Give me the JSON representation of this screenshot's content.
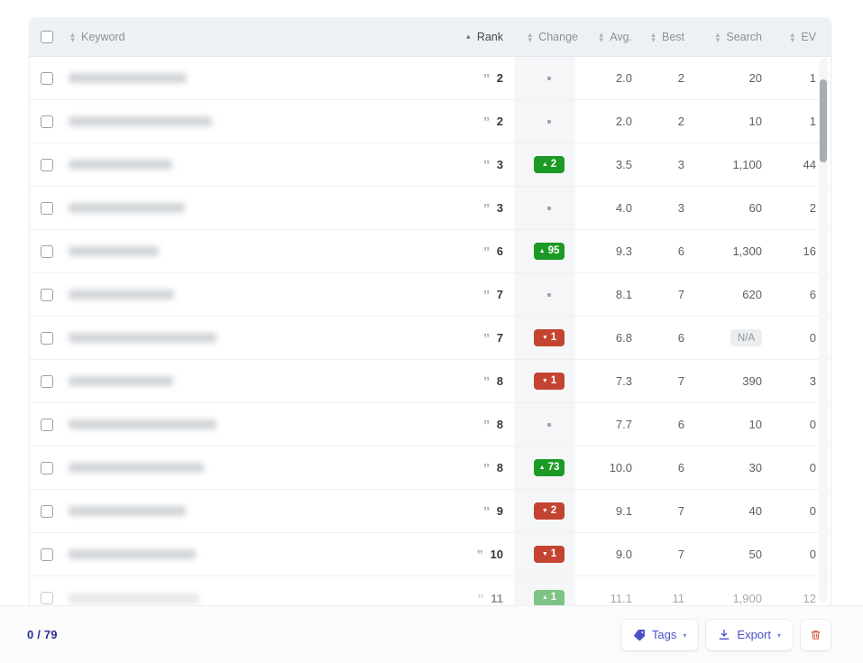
{
  "table": {
    "columns": [
      {
        "key": "select",
        "label": "",
        "sort": "none"
      },
      {
        "key": "keyword",
        "label": "Keyword",
        "sort": "both"
      },
      {
        "key": "rank",
        "label": "Rank",
        "sort": "asc"
      },
      {
        "key": "change",
        "label": "Change",
        "sort": "both"
      },
      {
        "key": "avg",
        "label": "Avg.",
        "sort": "both"
      },
      {
        "key": "best",
        "label": "Best",
        "sort": "both"
      },
      {
        "key": "search",
        "label": "Search",
        "sort": "both"
      },
      {
        "key": "ev",
        "label": "EV",
        "sort": "both"
      }
    ],
    "rank_icon": "quote-icon",
    "rows": [
      {
        "keyword": "",
        "keyword_redacted": true,
        "keyword_width": 131,
        "rank": "2",
        "change": "",
        "change_dir": "none",
        "avg": "2.0",
        "best": "2",
        "search": "20",
        "ev": "1"
      },
      {
        "keyword": "",
        "keyword_redacted": true,
        "keyword_width": 159,
        "rank": "2",
        "change": "",
        "change_dir": "none",
        "avg": "2.0",
        "best": "2",
        "search": "10",
        "ev": "1"
      },
      {
        "keyword": "",
        "keyword_redacted": true,
        "keyword_width": 115,
        "rank": "3",
        "change": "2",
        "change_dir": "up",
        "avg": "3.5",
        "best": "3",
        "search": "1,100",
        "ev": "44"
      },
      {
        "keyword": "",
        "keyword_redacted": true,
        "keyword_width": 129,
        "rank": "3",
        "change": "",
        "change_dir": "none",
        "avg": "4.0",
        "best": "3",
        "search": "60",
        "ev": "2"
      },
      {
        "keyword": "",
        "keyword_redacted": true,
        "keyword_width": 100,
        "rank": "6",
        "change": "95",
        "change_dir": "up",
        "avg": "9.3",
        "best": "6",
        "search": "1,300",
        "ev": "16"
      },
      {
        "keyword": "",
        "keyword_redacted": true,
        "keyword_width": 117,
        "rank": "7",
        "change": "",
        "change_dir": "none",
        "avg": "8.1",
        "best": "7",
        "search": "620",
        "ev": "6"
      },
      {
        "keyword": "",
        "keyword_redacted": true,
        "keyword_width": 164,
        "rank": "7",
        "change": "1",
        "change_dir": "down",
        "avg": "6.8",
        "best": "6",
        "search": "N/A",
        "ev": "0",
        "search_na": true
      },
      {
        "keyword": "",
        "keyword_redacted": true,
        "keyword_width": 116,
        "rank": "8",
        "change": "1",
        "change_dir": "down",
        "avg": "7.3",
        "best": "7",
        "search": "390",
        "ev": "3"
      },
      {
        "keyword": "",
        "keyword_redacted": true,
        "keyword_width": 164,
        "rank": "8",
        "change": "",
        "change_dir": "none",
        "avg": "7.7",
        "best": "6",
        "search": "10",
        "ev": "0"
      },
      {
        "keyword": "",
        "keyword_redacted": true,
        "keyword_width": 150,
        "rank": "8",
        "change": "73",
        "change_dir": "up",
        "avg": "10.0",
        "best": "6",
        "search": "30",
        "ev": "0"
      },
      {
        "keyword": "",
        "keyword_redacted": true,
        "keyword_width": 130,
        "rank": "9",
        "change": "2",
        "change_dir": "down",
        "avg": "9.1",
        "best": "7",
        "search": "40",
        "ev": "0"
      },
      {
        "keyword": "",
        "keyword_redacted": true,
        "keyword_width": 141,
        "rank": "10",
        "change": "1",
        "change_dir": "down",
        "avg": "9.0",
        "best": "7",
        "search": "50",
        "ev": "0"
      },
      {
        "keyword": "",
        "keyword_redacted": true,
        "keyword_width": 145,
        "rank": "11",
        "change": "1",
        "change_dir": "up",
        "avg": "11.1",
        "best": "11",
        "search": "1,900",
        "ev": "12"
      }
    ]
  },
  "footer": {
    "counter": "0 / 79",
    "tags_label": "Tags",
    "export_label": "Export",
    "chevron": "▾",
    "delete_label": ""
  },
  "colors": {
    "accent": "#4b51c4",
    "up": "#1c9a26",
    "down": "#c34430",
    "counter": "#2a2f8f",
    "delete": "#d4583c",
    "header_bg": "#eef1f4"
  }
}
